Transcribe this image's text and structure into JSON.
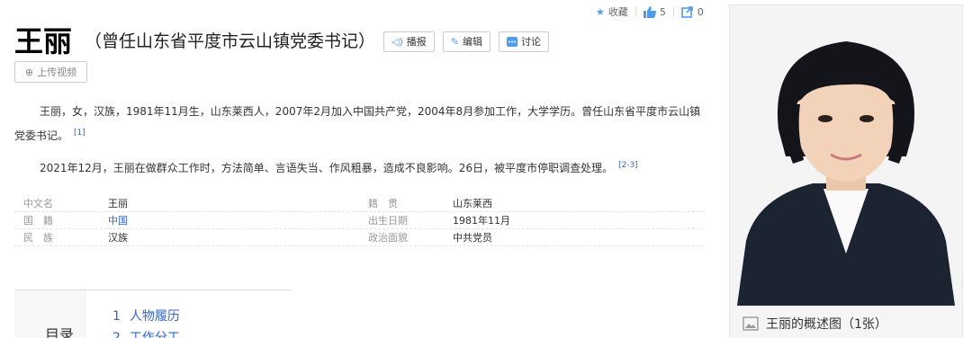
{
  "top_actions": {
    "collect_label": "收藏",
    "like_count": "5",
    "share_count": "0"
  },
  "title": {
    "main": "王丽",
    "subtitle": "（曾任山东省平度市云山镇党委书记）"
  },
  "buttons": {
    "broadcast": "播报",
    "edit": "编辑",
    "discuss": "讨论",
    "upload_video": "上传视频"
  },
  "paragraphs": [
    {
      "text": "王丽，女，汉族，1981年11月生，山东莱西人，2007年2月加入中国共产党，2004年8月参加工作，大学学历。曾任山东省平度市云山镇党委书记。",
      "ref": "[1]"
    },
    {
      "text": "2021年12月，王丽在做群众工作时，方法简单、言语失当、作风粗暴，造成不良影响。26日，被平度市停职调查处理。",
      "ref": "[2-3]"
    }
  ],
  "info": {
    "left": [
      {
        "k": "中文名",
        "v": "王丽"
      },
      {
        "k": "国　籍",
        "v": "中国"
      },
      {
        "k": "民　族",
        "v": "汉族"
      }
    ],
    "right": [
      {
        "k": "籍　贯",
        "v": "山东莱西"
      },
      {
        "k": "出生日期",
        "v": "1981年11月"
      },
      {
        "k": "政治面貌",
        "v": "中共党员"
      }
    ]
  },
  "catalog": {
    "title": "目录",
    "items": [
      {
        "num": "1",
        "label": "人物履历"
      },
      {
        "num": "2",
        "label": "工作分工"
      }
    ]
  },
  "photo": {
    "caption": "王丽的概述图（1张）"
  },
  "colors": {
    "link": "#3366cc",
    "accent": "#4f9cee"
  }
}
